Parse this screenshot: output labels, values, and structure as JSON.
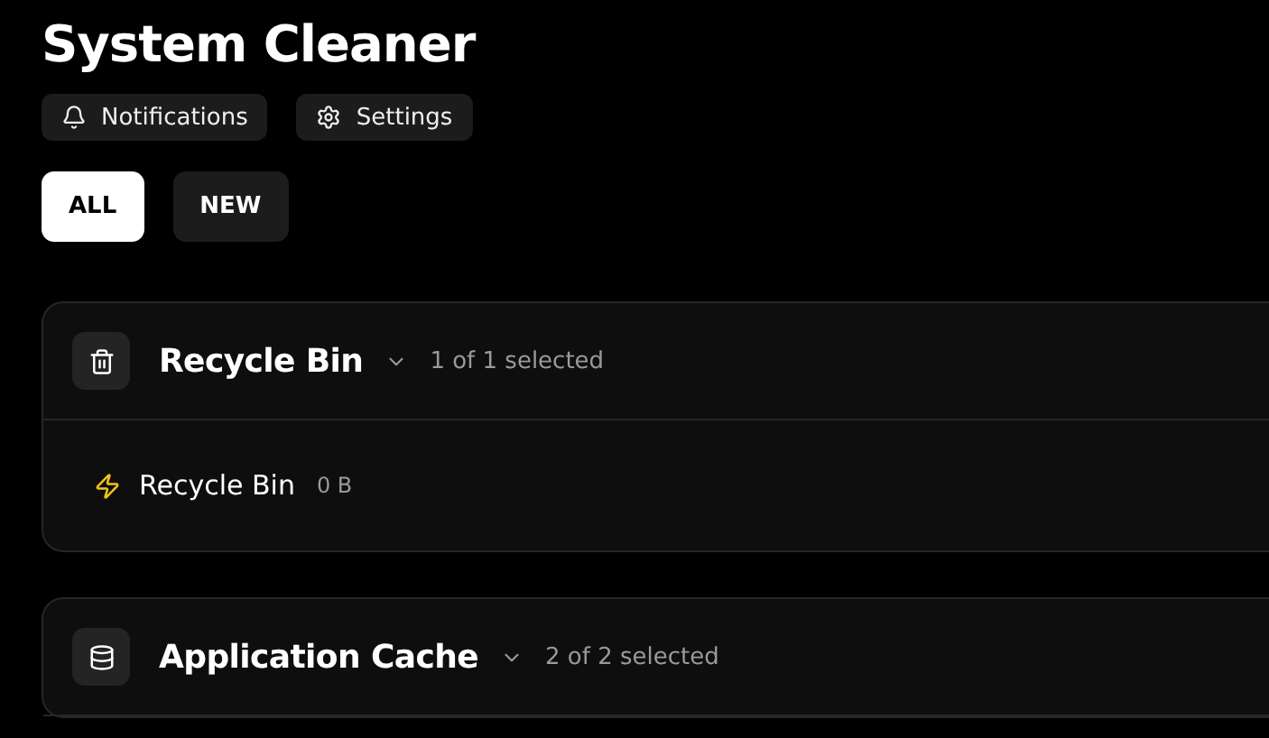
{
  "title": "System Cleaner",
  "actions": [
    {
      "kind": "notifications",
      "label": "Notifications"
    },
    {
      "kind": "settings",
      "label": "Settings"
    }
  ],
  "filters": [
    {
      "label": "ALL",
      "selected": true
    },
    {
      "label": "NEW",
      "selected": false
    }
  ],
  "categories": [
    {
      "kind": "trash",
      "name": "Recycle Bin",
      "count": "1 of 1 selected",
      "items": [
        {
          "name": "Recycle Bin",
          "size": "0 B"
        }
      ]
    },
    {
      "kind": "database",
      "name": "Application Cache",
      "count": "2 of 2 selected"
    }
  ]
}
